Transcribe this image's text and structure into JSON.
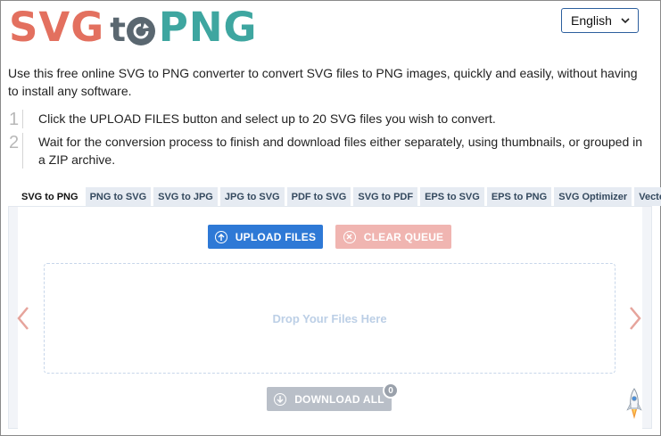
{
  "logo": {
    "part1": "SVG",
    "part2_t": "t",
    "part3": "PNG",
    "alt": "SVG to PNG"
  },
  "language": {
    "selected": "English"
  },
  "intro": "Use this free online SVG to PNG converter to convert SVG files to PNG images, quickly and easily, without having to install any software.",
  "steps": [
    {
      "num": "1",
      "text": "Click the UPLOAD FILES button and select up to 20 SVG files you wish to convert."
    },
    {
      "num": "2",
      "text": "Wait for the conversion process to finish and download files either separately, using thumbnails, or grouped in a ZIP archive."
    }
  ],
  "tabs": [
    {
      "label": "SVG to PNG",
      "active": true
    },
    {
      "label": "PNG to SVG"
    },
    {
      "label": "SVG to JPG"
    },
    {
      "label": "JPG to SVG"
    },
    {
      "label": "PDF to SVG"
    },
    {
      "label": "SVG to PDF"
    },
    {
      "label": "EPS to SVG"
    },
    {
      "label": "EPS to PNG"
    },
    {
      "label": "SVG Optimizer"
    },
    {
      "label": "Vectorizer"
    }
  ],
  "buttons": {
    "upload": "UPLOAD FILES",
    "clear": "CLEAR QUEUE",
    "download": "DOWNLOAD ALL",
    "download_count": "0"
  },
  "dropzone": {
    "text": "Drop Your Files Here"
  },
  "colors": {
    "logo_svg": "#e3705f",
    "logo_to": "#5a6770",
    "logo_png": "#3ea6a0",
    "upload_button": "#2e79d6",
    "clear_button": "#f0b5b1",
    "download_button": "#b9bfc8",
    "arrow": "#e6a49c"
  },
  "icons": {
    "upload": "upload-circle-icon",
    "clear": "clear-circle-icon",
    "download": "download-circle-icon",
    "prev": "chevron-left-icon",
    "next": "chevron-right-icon",
    "rocket": "rocket-icon",
    "lang": "chevron-down-icon"
  }
}
